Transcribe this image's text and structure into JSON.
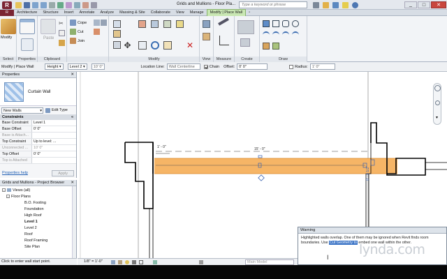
{
  "titlebar": {
    "title": "Grids and Mullions - Floor Pla...",
    "search_placeholder": "Type a keyword or phrase"
  },
  "ribbon": {
    "tabs": [
      {
        "label": "Architecture"
      },
      {
        "label": "Structure"
      },
      {
        "label": "Insert"
      },
      {
        "label": "Annotate"
      },
      {
        "label": "Analyze"
      },
      {
        "label": "Massing & Site"
      },
      {
        "label": "Collaborate"
      },
      {
        "label": "View"
      },
      {
        "label": "Manage"
      },
      {
        "label": "Modify | Place Wall"
      }
    ],
    "panels": {
      "select": "Select",
      "properties": "Properties",
      "clipboard": "Clipboard",
      "geometry_unused": "",
      "modify": "Modify",
      "view": "View",
      "measure": "Measure",
      "create": "Create",
      "draw": "Draw"
    },
    "modify_btn": "Modify",
    "paste_btn": "Paste",
    "cope": "Cope",
    "cut": "Cut",
    "join": "Join"
  },
  "options": {
    "context": "Modify | Place Wall",
    "height_label": "Height",
    "level": "Level 2",
    "offset_value": "10'  0\"",
    "location_line_label": "Location Line:",
    "location_line": "Wall Centerline",
    "chain": "Chain",
    "offset_label": "Offset:",
    "offset_input": "0'  0\"",
    "radius_label": "Radius:",
    "radius_value": "1'  0\""
  },
  "properties": {
    "header": "Properties",
    "type_name": "Curtain Wall",
    "instance_selector": "New Walls",
    "edit_type": "Edit Type",
    "section": "Constraints",
    "rows": [
      {
        "k": "Base Constraint",
        "v": "Level 1"
      },
      {
        "k": "Base Offset",
        "v": "0'  0\""
      },
      {
        "k": "Base is Attach...",
        "v": ""
      },
      {
        "k": "Top Constraint",
        "v": "Up to level: ..."
      },
      {
        "k": "Unconnected ...",
        "v": "10'  0\""
      },
      {
        "k": "Top Offset",
        "v": "0'  0\""
      },
      {
        "k": "Top is Attached",
        "v": ""
      }
    ],
    "help": "Properties help",
    "apply": "Apply"
  },
  "browser": {
    "header": "Grids and Mullions - Project Browser",
    "nodes": [
      {
        "label": "Views (all)"
      },
      {
        "label": "Floor Plans"
      },
      {
        "label": "B.O. Footing"
      },
      {
        "label": "Foundation"
      },
      {
        "label": "High Roof"
      },
      {
        "label": "Level 1"
      },
      {
        "label": "Level 2"
      },
      {
        "label": "Roof"
      },
      {
        "label": "Roof Framing"
      },
      {
        "label": "Site Plan"
      }
    ]
  },
  "canvas": {
    "dim1": "1' - 0\"",
    "dim2": "15' - 0\"",
    "dim3": "0' - 0 1/2\""
  },
  "view_controls": {
    "scale": "1/8\" = 1'-0\"",
    "model": "Main Model"
  },
  "status": "Click to enter wall start point.",
  "warning": {
    "title": "Warning",
    "text_a": "Highlighted walls overlap. One of them may be ignored when Revit finds room boundaries. Use ",
    "highlight": "Cut Geometry to",
    "text_b": " embed one wall within the other."
  },
  "watermark": "lynda.com",
  "colors": {
    "wall_highlight": "#f6b566",
    "context_tab": "#c9e7b3"
  }
}
